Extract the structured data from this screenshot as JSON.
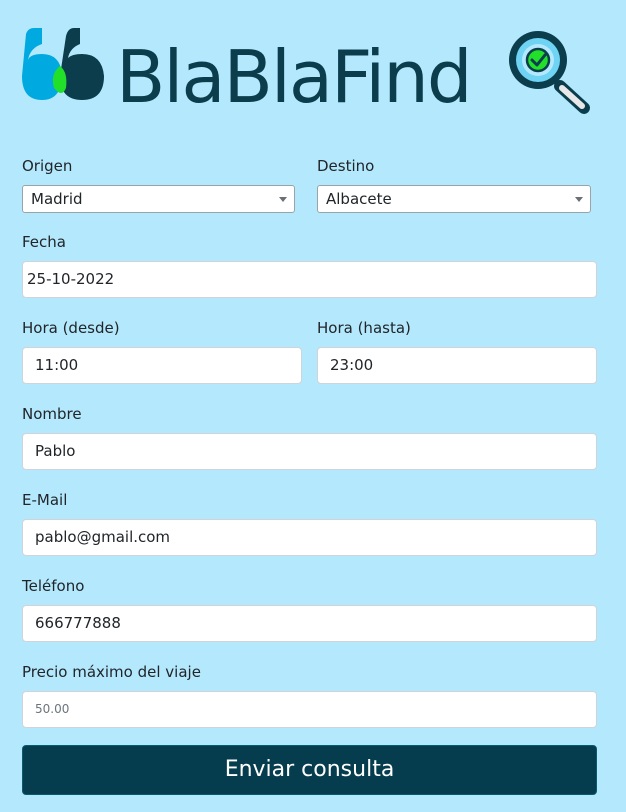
{
  "brand": {
    "name": "BlaBlaFind",
    "colors": {
      "dark": "#0b3d4d",
      "blue": "#00a9e0",
      "green": "#22e02a",
      "background": "#b4e9fd"
    },
    "icons": [
      "blablacar-quote-logo-icon",
      "magnifier-check-icon"
    ]
  },
  "form": {
    "origin": {
      "label": "Origen",
      "selected": "Madrid"
    },
    "destination": {
      "label": "Destino",
      "selected": "Albacete"
    },
    "date": {
      "label": "Fecha",
      "value": "25-10-2022"
    },
    "time_from": {
      "label": "Hora (desde)",
      "value": "11:00"
    },
    "time_to": {
      "label": "Hora (hasta)",
      "value": "23:00"
    },
    "name": {
      "label": "Nombre",
      "value": "Pablo"
    },
    "email": {
      "label": "E-Mail",
      "value": "pablo@gmail.com"
    },
    "phone": {
      "label": "Teléfono",
      "value": "666777888"
    },
    "max_price": {
      "label": "Precio máximo del viaje",
      "value": "50.00"
    },
    "submit_label": "Enviar consulta"
  }
}
